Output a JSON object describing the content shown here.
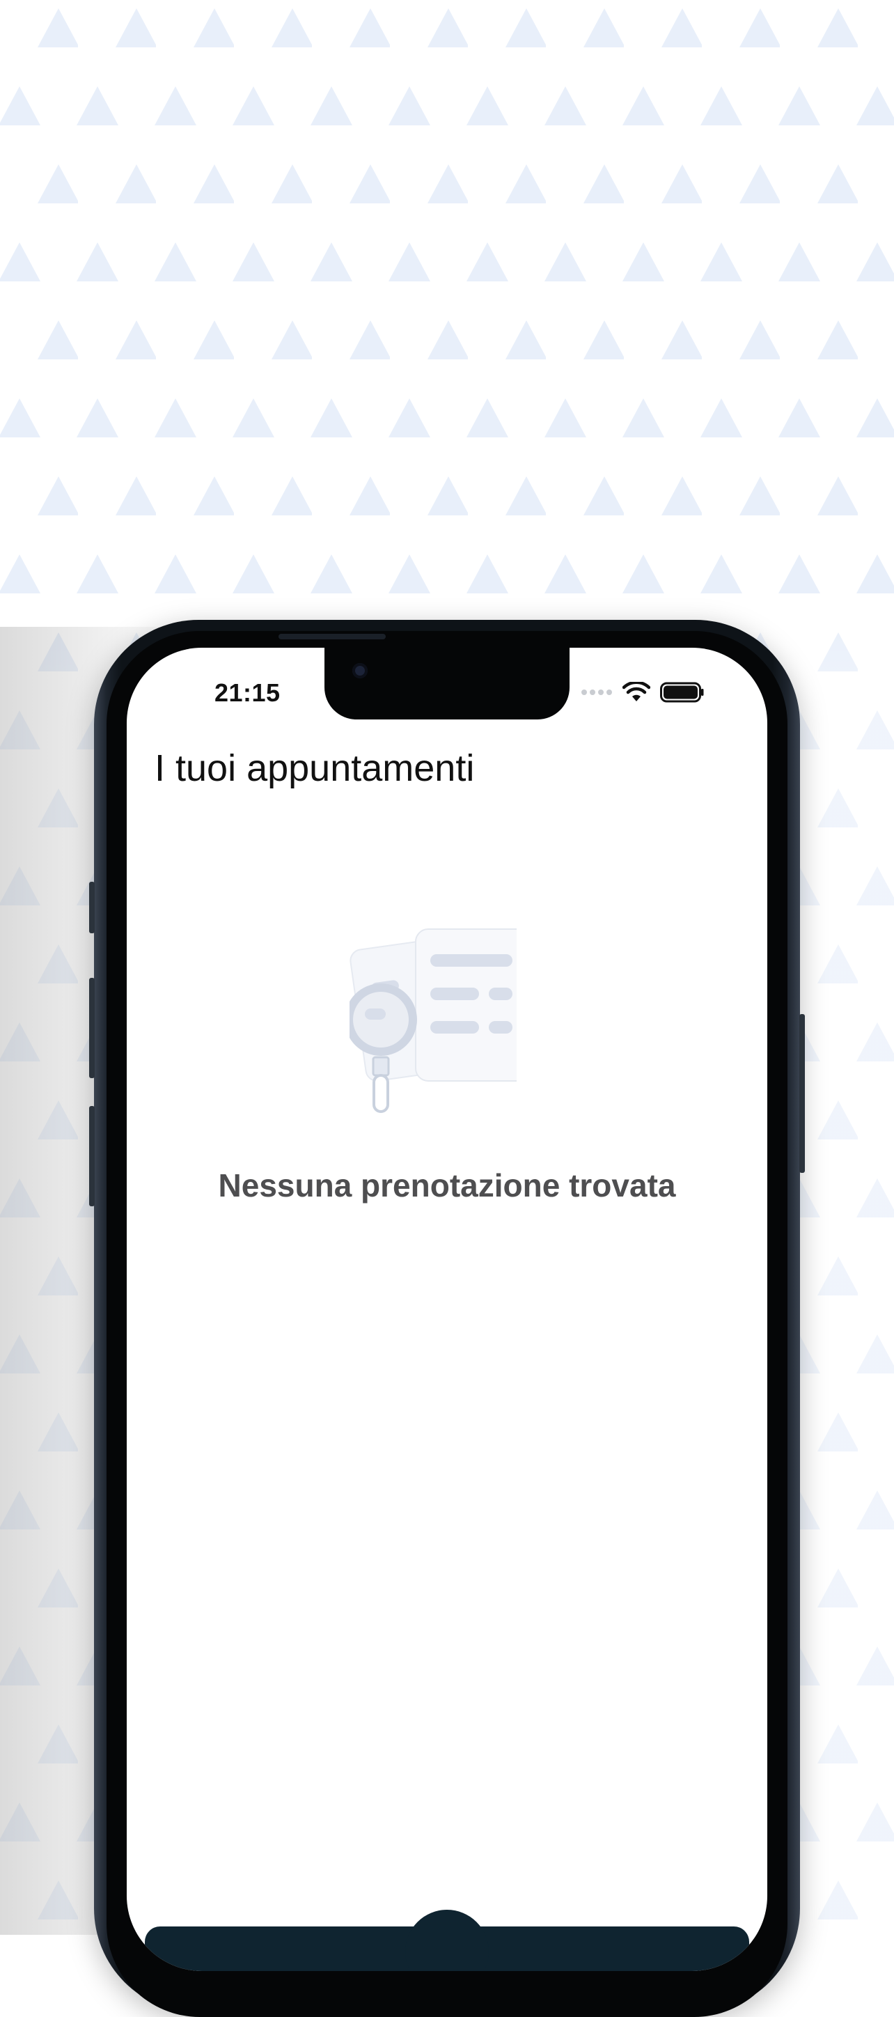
{
  "status_bar": {
    "time": "21:15"
  },
  "header": {
    "title": "I tuoi appuntamenti"
  },
  "empty_state": {
    "message": "Nessuna prenotazione trovata",
    "illustration": "documents-search-icon"
  },
  "colors": {
    "pattern_triangle": "#e8effa",
    "phone_body": "#0e1318",
    "bottom_bar": "#0f2430",
    "empty_text": "#4e4e50",
    "illustration_lines": "#d8deea"
  },
  "icons": {
    "signal": "signal-dots-icon",
    "wifi": "wifi-icon",
    "battery": "battery-icon"
  }
}
